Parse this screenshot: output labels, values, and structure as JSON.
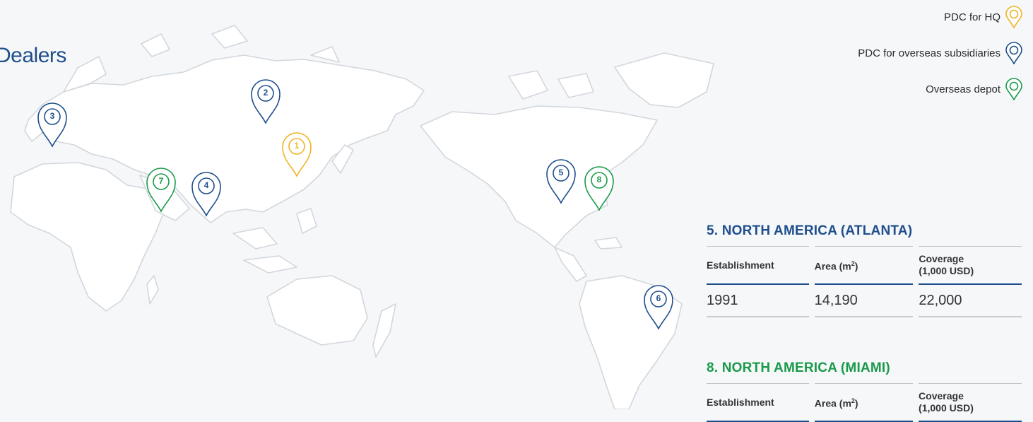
{
  "page_title": "Dealers",
  "legend": [
    {
      "label": "PDC for HQ",
      "color": "#f0b323",
      "icon": "map-pin-icon"
    },
    {
      "label": "PDC for overseas subsidiaries",
      "color": "#1f4e8c",
      "icon": "map-pin-icon"
    },
    {
      "label": "Overseas depot",
      "color": "#1a9a4a",
      "icon": "map-pin-icon"
    }
  ],
  "markers": [
    {
      "number": "1",
      "type": "hq",
      "color": "#f0b323"
    },
    {
      "number": "2",
      "type": "subsidiary",
      "color": "#1f4e8c"
    },
    {
      "number": "3",
      "type": "subsidiary",
      "color": "#1f4e8c"
    },
    {
      "number": "4",
      "type": "subsidiary",
      "color": "#1f4e8c"
    },
    {
      "number": "5",
      "type": "subsidiary",
      "color": "#1f4e8c"
    },
    {
      "number": "6",
      "type": "subsidiary",
      "color": "#1f4e8c"
    },
    {
      "number": "7",
      "type": "depot",
      "color": "#1a9a4a"
    },
    {
      "number": "8",
      "type": "depot",
      "color": "#1a9a4a"
    }
  ],
  "info_cards": [
    {
      "title": "5. NORTH AMERICA (ATLANTA)",
      "headers": {
        "establishment": "Establishment",
        "area_prefix": "Area (m",
        "area_sup": "2",
        "area_suffix": ")",
        "coverage_line1": "Coverage",
        "coverage_line2": "(1,000 USD)"
      },
      "values": {
        "establishment": "1991",
        "area": "14,190",
        "coverage": "22,000"
      }
    },
    {
      "title": "8. NORTH AMERICA (MIAMI)",
      "headers": {
        "establishment": "Establishment",
        "area_prefix": "Area (m",
        "area_sup": "2",
        "area_suffix": ")",
        "coverage_line1": "Coverage",
        "coverage_line2": "(1,000 USD)"
      }
    }
  ]
}
